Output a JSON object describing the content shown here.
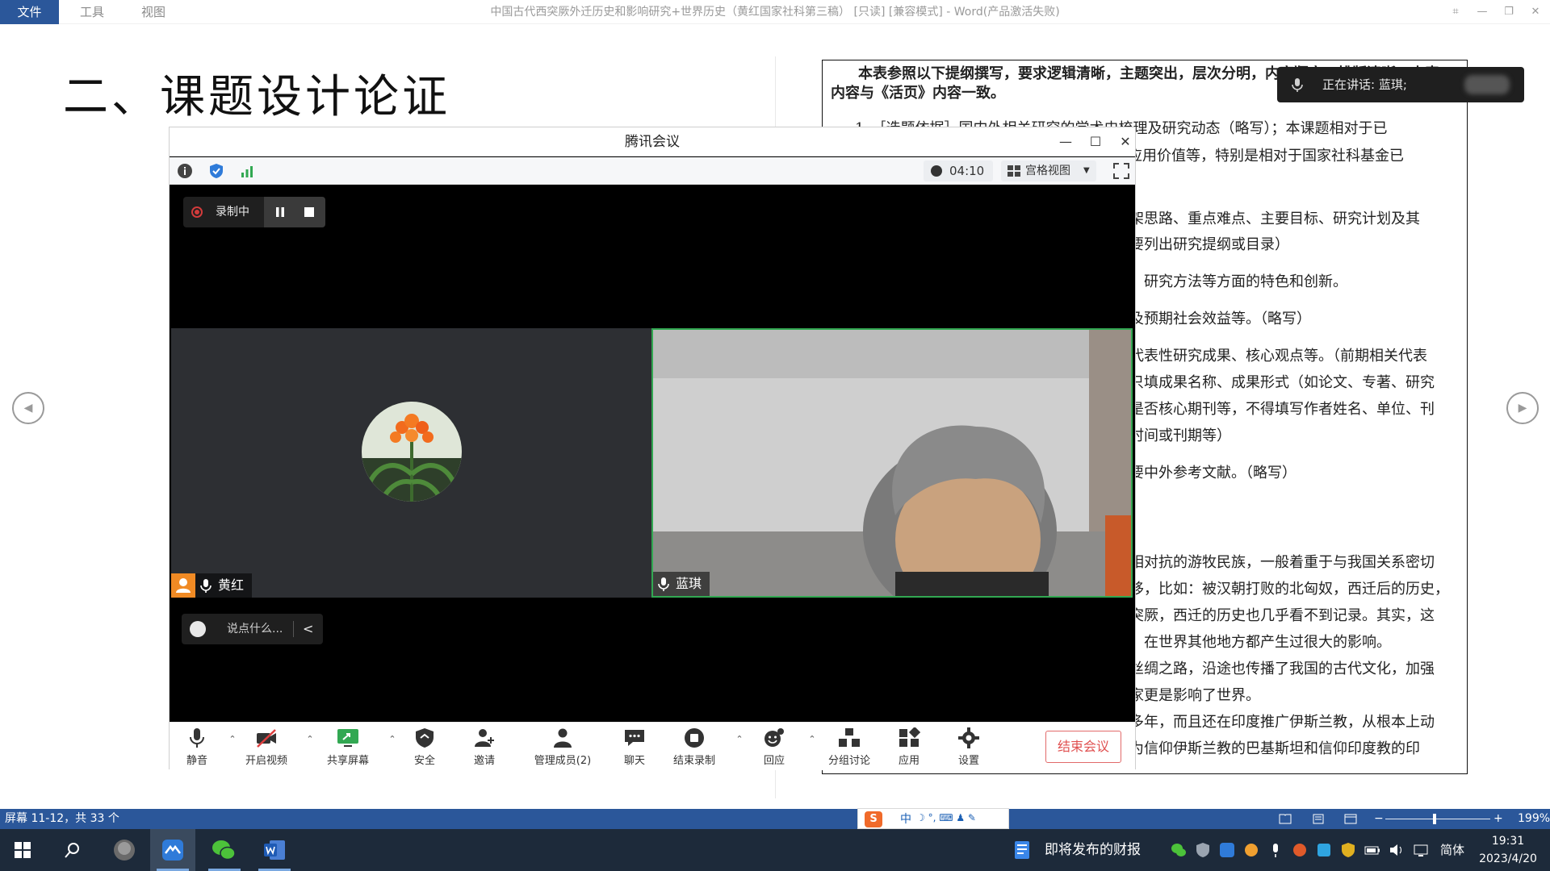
{
  "word": {
    "tabs": [
      "文件",
      "工具",
      "视图"
    ],
    "doc_title": "中国古代西突厥外迁历史和影响研究+世界历史（黄红国家社科第三稿） [只读] [兼容模式] - Word(产品激活失败)",
    "heading": "二、课题设计论证",
    "doc_lines": [
      "本表参照以下提纲撰写，要求逻辑清晰，主题突出，层次分明，内容翔实，排版清晰。本表",
      "内容与《活页》内容一致。",
      "1．［选题依据］国内外相关研究的学术史梳理及研究动态（略写）；本课题相对于已",
      "和应用价值等，特别是相对于国家社科基金已",
      "架思路、重点难点、主要目标、研究计划及其",
      "要列出研究提纲或目录）",
      "、研究方法等方面的特色和创新。",
      "及预期社会效益等。（略写）",
      "代表性研究成果、核心观点等。（前期相关代表",
      "只填成果名称、成果形式（如论文、专著、研究",
      "是否核心期刊等，不得填写作者姓名、单位、刊",
      "时间或刊期等）",
      "要中外参考文献。（略写）",
      "相对抗的游牧民族，一般着重于与我国关系密切",
      "移，比如：被汉朝打败的北匈奴，西迁后的历史，",
      "突厥，西迁的历史也几乎看不到记录。其实，这",
      "，在世界其他地方都产生过很大的影响。",
      "丝绸之路，沿途也传播了我国的古代文化，加强",
      "家更是影响了世界。",
      "多年，而且还在印度推广伊斯兰教，从根本上动",
      "为信仰伊斯兰教的巴基斯坦和信仰印度教的印"
    ],
    "status": {
      "pages": "屏幕 11-12，共 33 个",
      "zoom": "199%",
      "ime_s": "S",
      "ime_lang": "中",
      "ime_rest": "☽ °, ⌨ ♟ ✎"
    }
  },
  "speaking_notice": "正在讲话: 蓝琪;",
  "meeting": {
    "title": "腾讯会议",
    "timer": "04:10",
    "view_label": "宫格视图",
    "recording_label": "录制中",
    "participants": [
      {
        "name": "黄红",
        "video": false
      },
      {
        "name": "蓝琪",
        "video": true
      }
    ],
    "chat_placeholder": "说点什么...",
    "chat_chevron": "<",
    "toolbar": [
      {
        "label": "静音",
        "icon": "mic-icon",
        "caret": true
      },
      {
        "label": "开启视频",
        "icon": "camera-off-icon",
        "caret": true
      },
      {
        "label": "共享屏幕",
        "icon": "share-screen-icon",
        "caret": true
      },
      {
        "label": "安全",
        "icon": "shield-icon",
        "caret": false
      },
      {
        "label": "邀请",
        "icon": "invite-icon",
        "caret": false
      },
      {
        "label": "管理成员(2)",
        "icon": "members-icon",
        "caret": false
      },
      {
        "label": "聊天",
        "icon": "chat-icon",
        "caret": false
      },
      {
        "label": "结束录制",
        "icon": "stop-record-icon",
        "caret": true
      },
      {
        "label": "回应",
        "icon": "reaction-icon",
        "caret": true
      },
      {
        "label": "分组讨论",
        "icon": "breakout-icon",
        "caret": false
      },
      {
        "label": "应用",
        "icon": "apps-icon",
        "caret": false
      },
      {
        "label": "设置",
        "icon": "settings-icon",
        "caret": false
      }
    ],
    "end_label": "结束会议",
    "accent_green": "#32a852",
    "end_red": "#e05050"
  },
  "taskbar": {
    "notification": "即将发布的财报",
    "lang": "简体",
    "time": "19:31",
    "date": "2023/4/20"
  },
  "colors": {
    "word_blue": "#2b579a",
    "taskbar": "#1d2a3a"
  }
}
